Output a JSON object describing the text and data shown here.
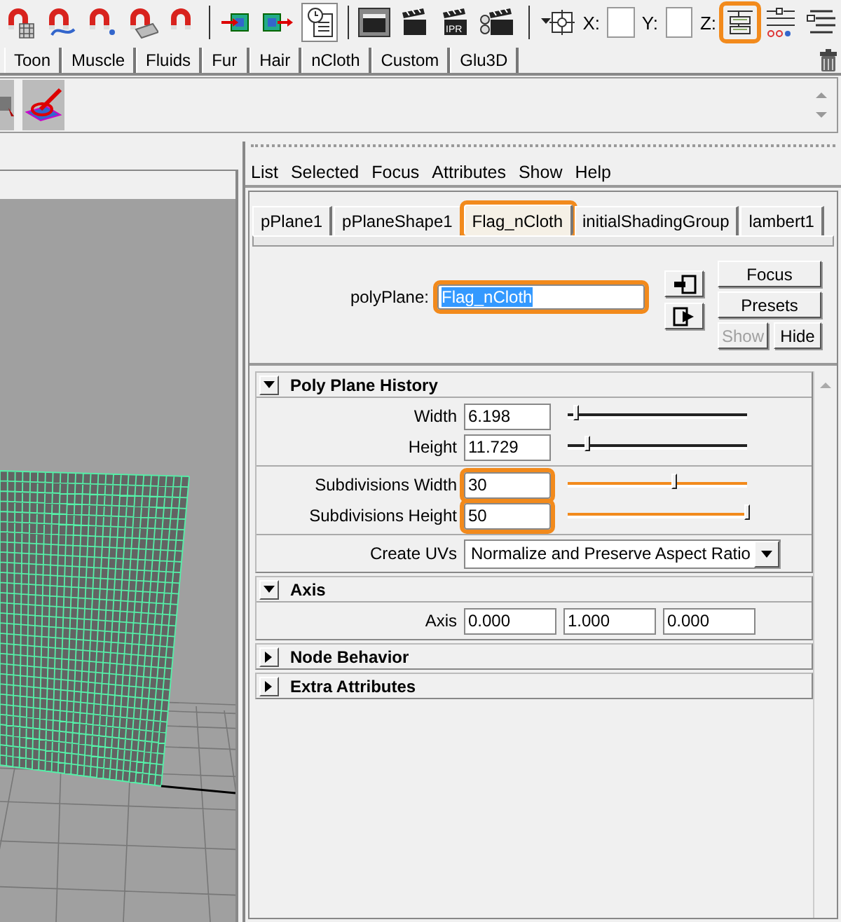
{
  "toolbar": {
    "history_pressed": true,
    "ipr_label": "IPR",
    "coord_labels": [
      "X:",
      "Y:"
    ],
    "z_label": "Z:",
    "editor_toggle_highlighted": true
  },
  "shelf": {
    "tabs": [
      "Toon",
      "Muscle",
      "Fluids",
      "Fur",
      "Hair",
      "nCloth",
      "Custom",
      "Glu3D"
    ]
  },
  "attribute_editor": {
    "menu": [
      "List",
      "Selected",
      "Focus",
      "Attributes",
      "Show",
      "Help"
    ],
    "tabs": [
      {
        "label": "pPlane1",
        "selected": false,
        "highlighted": false
      },
      {
        "label": "pPlaneShape1",
        "selected": false,
        "highlighted": false
      },
      {
        "label": "Flag_nCloth",
        "selected": true,
        "highlighted": true
      },
      {
        "label": "initialShadingGroup",
        "selected": false,
        "highlighted": false
      },
      {
        "label": "lambert1",
        "selected": false,
        "highlighted": false
      }
    ],
    "node_label": "polyPlane:",
    "node_name": {
      "value": "Flag_nCloth",
      "text_selected": true,
      "highlighted": true
    },
    "buttons": [
      {
        "label": "Focus",
        "disabled": false
      },
      {
        "label": "Presets",
        "disabled": false
      },
      {
        "label": "Show",
        "disabled": true
      },
      {
        "label": "Hide",
        "disabled": false
      }
    ],
    "sections": [
      {
        "title": "Poly Plane History",
        "expanded": true,
        "groups": [
          [
            {
              "kind": "slider",
              "label": "Width",
              "value": "6.198",
              "level": 0.05,
              "highlighted": false
            },
            {
              "kind": "slider",
              "label": "Height",
              "value": "11.729",
              "level": 0.11,
              "highlighted": false
            }
          ],
          [
            {
              "kind": "slider",
              "label": "Subdivisions Width",
              "value": "30",
              "level": 0.59,
              "highlighted": true
            },
            {
              "kind": "slider",
              "label": "Subdivisions Height",
              "value": "50",
              "level": 1,
              "highlighted": true
            }
          ],
          [
            {
              "kind": "dropdown",
              "label": "Create UVs",
              "value": "Normalize and Preserve Aspect Ratio"
            }
          ]
        ]
      },
      {
        "title": "Axis",
        "expanded": true,
        "groups": [
          [
            {
              "kind": "vector",
              "label": "Axis",
              "values": [
                "0.000",
                "1.000",
                "0.000"
              ]
            }
          ]
        ]
      },
      {
        "title": "Node Behavior",
        "expanded": false
      },
      {
        "title": "Extra Attributes",
        "expanded": false
      }
    ]
  }
}
